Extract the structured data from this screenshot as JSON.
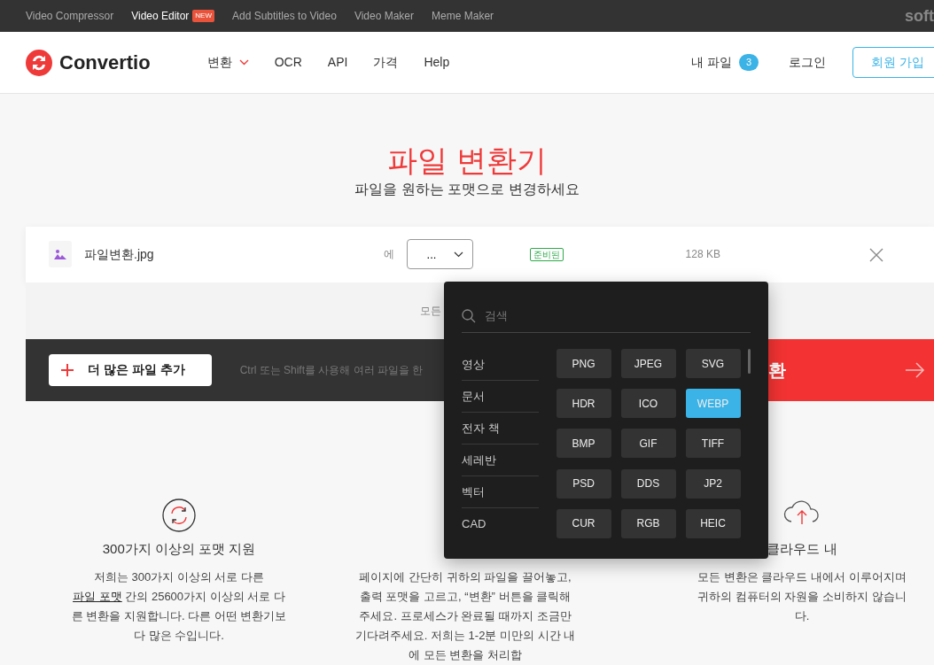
{
  "top_links": [
    {
      "label": "Video Compressor",
      "current": false
    },
    {
      "label": "Video Editor",
      "current": true,
      "badge": "NEW"
    },
    {
      "label": "Add Subtitles to Video",
      "current": false
    },
    {
      "label": "Video Maker",
      "current": false
    },
    {
      "label": "Meme Maker",
      "current": false
    }
  ],
  "top_brand": "soft",
  "navbar": {
    "logo": "Convertio",
    "menu": [
      {
        "label": "변환",
        "dropdown": true
      },
      {
        "label": "OCR",
        "dropdown": false
      },
      {
        "label": "API",
        "dropdown": false
      },
      {
        "label": "가격",
        "dropdown": false
      },
      {
        "label": "Help",
        "dropdown": false
      }
    ],
    "my_files": {
      "label": "내 파일",
      "count": "3"
    },
    "login": "로그인",
    "signup": "회원 가입"
  },
  "hero": {
    "title": "파일 변환기",
    "subtitle": "파일을 원하는 포맷으로 변경하세요"
  },
  "file": {
    "name": "파일변환.jpg",
    "to_label": "에",
    "format": "...",
    "status": "준비된",
    "size": "128 KB"
  },
  "drop_hint": "모든",
  "add_button": "더 많은 파일 추가",
  "hint": "Ctrl 또는 Shift를 사용해 여러 파일을 한",
  "convert_button": "환",
  "format_menu": {
    "search": {
      "placeholder": "검색"
    },
    "categories": [
      {
        "label": "영상",
        "selected": false
      },
      {
        "label": "문서",
        "selected": false
      },
      {
        "label": "전자 책",
        "selected": false
      },
      {
        "label": "세레반",
        "selected": false
      },
      {
        "label": "벡터",
        "selected": false
      },
      {
        "label": "CAD",
        "selected": false
      }
    ],
    "formats": [
      {
        "label": "PNG",
        "selected": false
      },
      {
        "label": "JPEG",
        "selected": false
      },
      {
        "label": "SVG",
        "selected": false
      },
      {
        "label": "HDR",
        "selected": false
      },
      {
        "label": "ICO",
        "selected": false
      },
      {
        "label": "WEBP",
        "selected": true
      },
      {
        "label": "BMP",
        "selected": false
      },
      {
        "label": "GIF",
        "selected": false
      },
      {
        "label": "TIFF",
        "selected": false
      },
      {
        "label": "PSD",
        "selected": false
      },
      {
        "label": "DDS",
        "selected": false
      },
      {
        "label": "JP2",
        "selected": false
      },
      {
        "label": "CUR",
        "selected": false
      },
      {
        "label": "RGB",
        "selected": false
      },
      {
        "label": "HEIC",
        "selected": false
      }
    ]
  },
  "features": [
    {
      "kind": "formats",
      "title": "300가지 이상의 포맷 지원",
      "text_before": "저희는 300가지 이상의 서로 다른 ",
      "link": "파일 포맷",
      "text_after": " 간의 25600가지 이상의 서로 다른 변환을 지원합니다. 다른 어떤 변환기보다 많은 수입니다."
    },
    {
      "kind": "speed",
      "text_before": "페이지에 간단히 귀하의 파일을 끌어놓고, 출력 포맷을 고르고, “변환” 버튼을 클릭해주세요. 프로세스가 완료될 때까지 조금만 기다려주세요. 저희는 1-2분 미만의 시간 내에 모든 변환을 처리합"
    },
    {
      "kind": "cloud",
      "title": "클라우드 내",
      "text_before": "모든 변환은 클라우드 내에서 이루어지며 귀하의 컴퓨터의 자원을 소비하지 않습니다."
    }
  ]
}
